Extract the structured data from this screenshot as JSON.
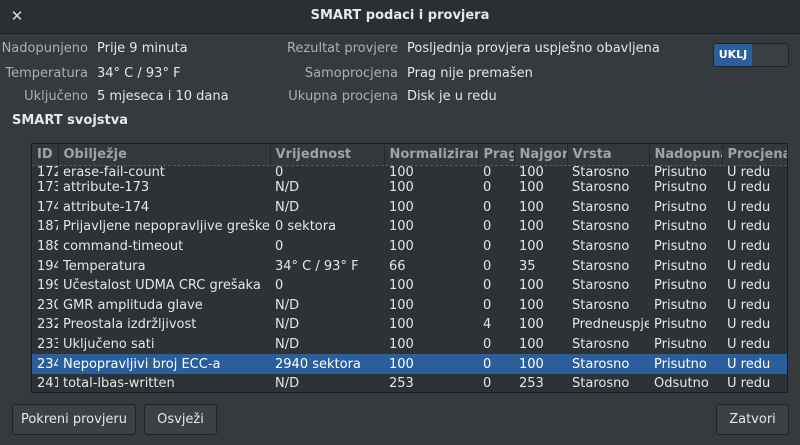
{
  "window": {
    "title": "SMART podaci i provjera"
  },
  "info_left": [
    {
      "label": "Nadopunjeno",
      "value": "Prije 9 minuta"
    },
    {
      "label": "Temperatura",
      "value": "34° C / 93° F"
    },
    {
      "label": "Uključeno",
      "value": "5 mjeseca i 10 dana"
    }
  ],
  "info_right": [
    {
      "label": "Rezultat provjere",
      "value": "Posljednja provjera uspješno obavljena"
    },
    {
      "label": "Samoprocjena",
      "value": "Prag nije premašen"
    },
    {
      "label": "Ukupna procjena",
      "value": "Disk je u redu"
    }
  ],
  "toggle": {
    "label": "UKLJ",
    "on": true
  },
  "section_title": "SMART svojstva",
  "table": {
    "columns": [
      "ID",
      "Obilježje",
      "Vrijednost",
      "Normalizirano",
      "Prag",
      "Najgori",
      "Vrsta",
      "Nadopuna",
      "Procjena"
    ],
    "rows": [
      [
        "172",
        "erase-fail-count",
        "0",
        "100",
        "0",
        "100",
        "Starosno",
        "Prisutno",
        "U redu"
      ],
      [
        "173",
        "attribute-173",
        "N/D",
        "100",
        "0",
        "100",
        "Starosno",
        "Prisutno",
        "U redu"
      ],
      [
        "174",
        "attribute-174",
        "N/D",
        "100",
        "0",
        "100",
        "Starosno",
        "Prisutno",
        "U redu"
      ],
      [
        "187",
        "Prijavljene nepopravljive greške",
        "0 sektora",
        "100",
        "0",
        "100",
        "Starosno",
        "Prisutno",
        "U redu"
      ],
      [
        "188",
        "command-timeout",
        "0",
        "100",
        "0",
        "100",
        "Starosno",
        "Prisutno",
        "U redu"
      ],
      [
        "194",
        "Temperatura",
        "34° C / 93° F",
        "66",
        "0",
        "35",
        "Starosno",
        "Prisutno",
        "U redu"
      ],
      [
        "199",
        "Učestalost UDMA CRC grešaka",
        "0",
        "100",
        "0",
        "100",
        "Starosno",
        "Prisutno",
        "U redu"
      ],
      [
        "230",
        "GMR amplituda glave",
        "N/D",
        "100",
        "0",
        "100",
        "Starosno",
        "Prisutno",
        "U redu"
      ],
      [
        "232",
        "Preostala izdržljivost",
        "N/D",
        "100",
        "4",
        "100",
        "Predneuspjeh",
        "Prisutno",
        "U redu"
      ],
      [
        "233",
        "Uključeno sati",
        "N/D",
        "100",
        "0",
        "100",
        "Starosno",
        "Prisutno",
        "U redu"
      ],
      [
        "234",
        "Nepopravljivi broj ECC-a",
        "2940 sektora",
        "100",
        "0",
        "100",
        "Starosno",
        "Prisutno",
        "U redu"
      ],
      [
        "241",
        "total-lbas-written",
        "N/D",
        "253",
        "0",
        "253",
        "Starosno",
        "Odsutno",
        "U redu"
      ]
    ],
    "selected_row": 10
  },
  "buttons": {
    "run_test": "Pokreni provjeru",
    "refresh": "Osvježi",
    "close": "Zatvori"
  },
  "icons": {
    "close": "close-icon"
  },
  "colors": {
    "accent": "#2a5f9c",
    "background": "#353a3f"
  }
}
